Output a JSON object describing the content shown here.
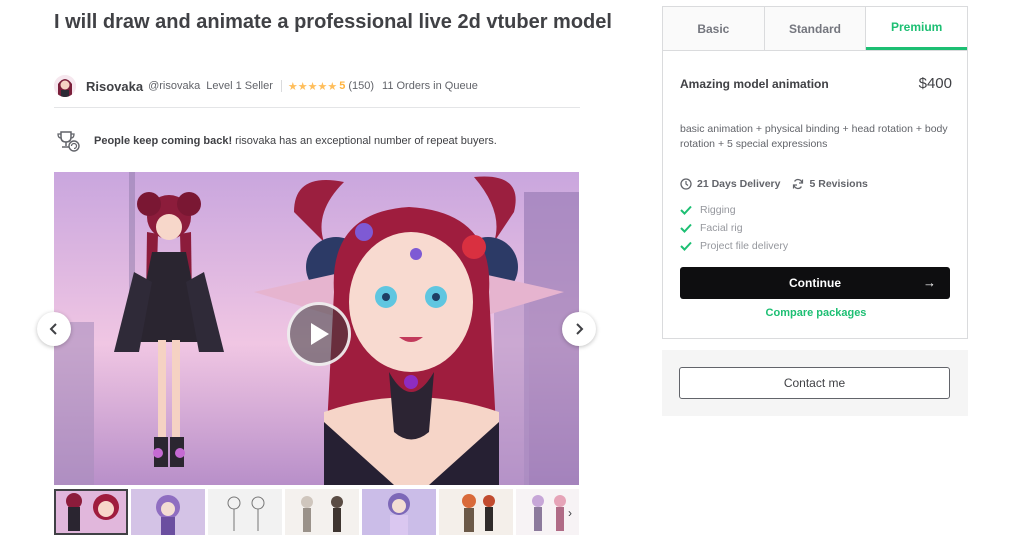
{
  "gig": {
    "title": "I will draw and animate a professional live 2d vtuber model"
  },
  "seller": {
    "name": "Risovaka",
    "handle": "@risovaka",
    "level": "Level 1 Seller",
    "stars": "★★★★★",
    "rating": "5",
    "review_count": "(150)",
    "queue": "11 Orders in Queue"
  },
  "repeat_buyers": {
    "bold": "People keep coming back!",
    "text": "risovaka has an exceptional number of repeat buyers."
  },
  "gallery": {
    "thumbnail_count": 7
  },
  "packages": {
    "tabs": [
      {
        "label": "Basic",
        "active": false
      },
      {
        "label": "Standard",
        "active": false
      },
      {
        "label": "Premium",
        "active": true
      }
    ],
    "selected": {
      "name": "Amazing model animation",
      "price": "$400",
      "description": "basic animation + physical binding + head rotation + body rotation + 5 special expressions",
      "delivery": "21 Days Delivery",
      "revisions": "5 Revisions",
      "features": [
        "Rigging",
        "Facial rig",
        "Project file delivery"
      ]
    },
    "continue_label": "Continue",
    "compare_label": "Compare packages"
  },
  "contact": {
    "label": "Contact me"
  },
  "colors": {
    "accent": "#1dbf73",
    "star": "#ffbe5b",
    "text": "#404145",
    "button_dark": "#0e0e10"
  },
  "icons": {
    "repeat": "trophy-repeat-icon",
    "play": "play-icon",
    "prev": "chevron-left-icon",
    "next": "chevron-right-icon",
    "delivery": "clock-icon",
    "revisions": "refresh-icon",
    "feature": "check-icon",
    "continue": "arrow-right-icon"
  }
}
